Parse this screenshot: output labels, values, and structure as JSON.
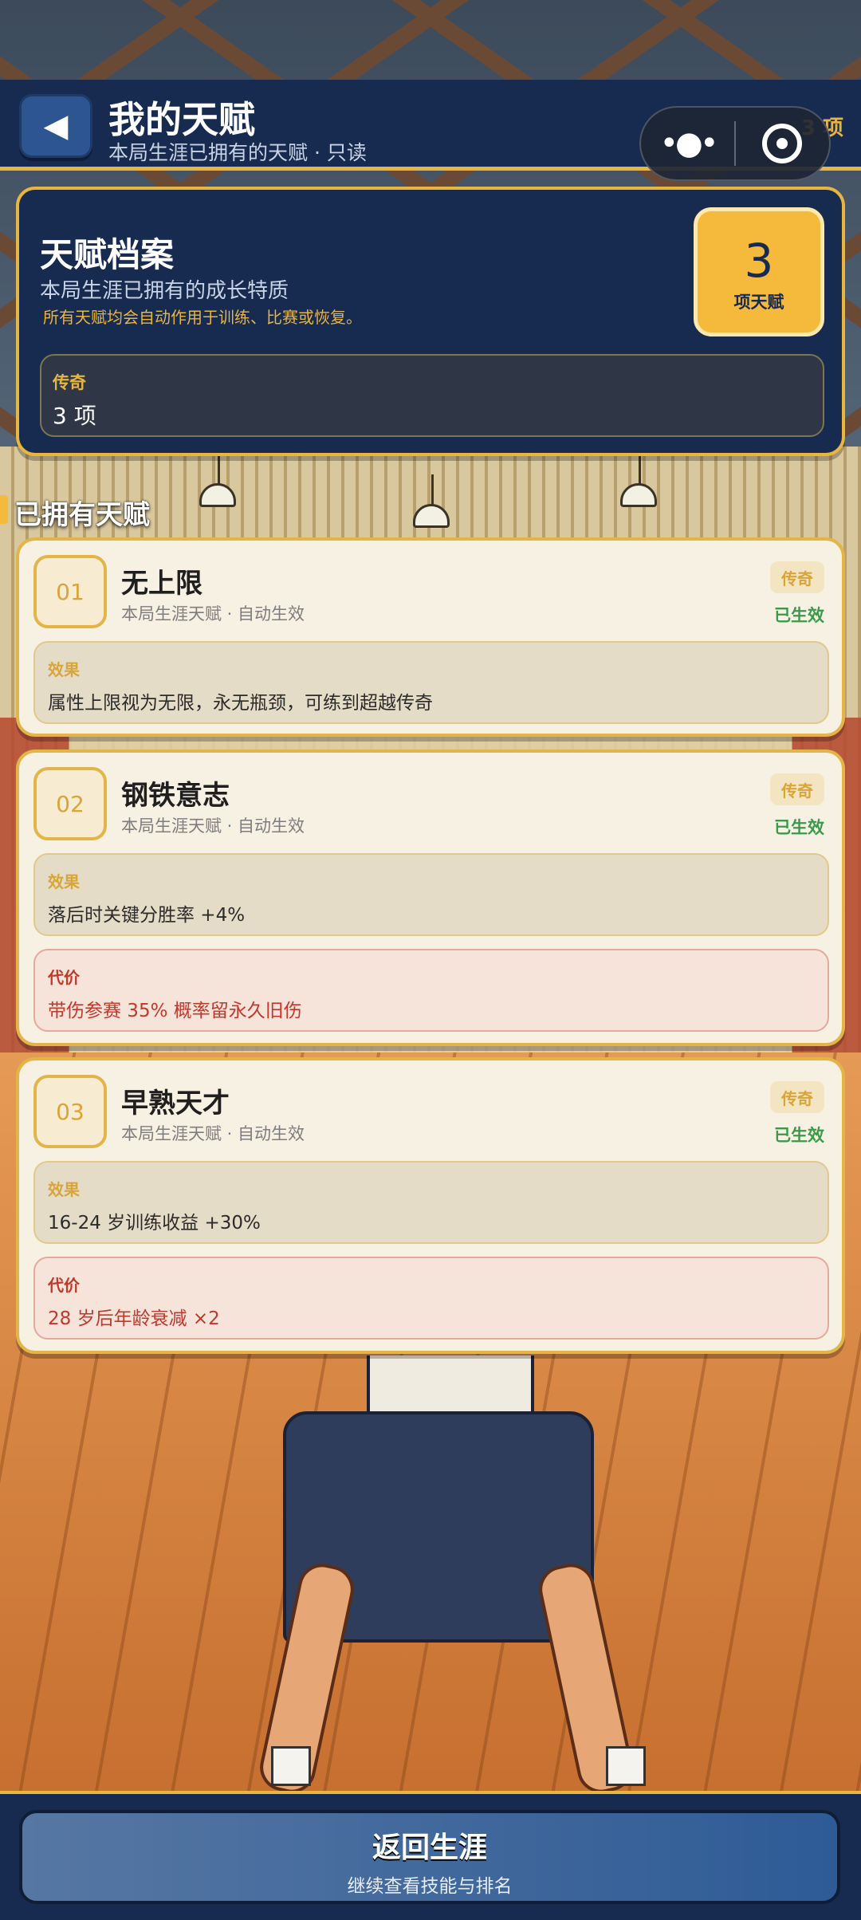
{
  "header": {
    "title": "我的天赋",
    "subtitle": "本局生涯已拥有的天赋 · 只读",
    "count_text": "3 项",
    "back_icon": "back-arrow-icon"
  },
  "capsule": {
    "more_icon": "more-dots-icon",
    "target_icon": "target-icon"
  },
  "profile": {
    "title": "天赋档案",
    "subtitle": "本局生涯已拥有的成长特质",
    "note": "所有天赋均会自动作用于训练、比赛或恢复。",
    "count": "3",
    "count_label": "项天赋",
    "rarity_name": "传奇",
    "rarity_value": "3 项"
  },
  "section": {
    "title": "已拥有天赋"
  },
  "talents": [
    {
      "index": "01",
      "name": "无上限",
      "meta": "本局生涯天赋 · 自动生效",
      "rarity": "传奇",
      "status": "已生效",
      "effect_label": "效果",
      "effect": "属性上限视为无限，永无瓶颈，可练到超越传奇"
    },
    {
      "index": "02",
      "name": "钢铁意志",
      "meta": "本局生涯天赋 · 自动生效",
      "rarity": "传奇",
      "status": "已生效",
      "effect_label": "效果",
      "effect": "落后时关键分胜率 +4%",
      "cost_label": "代价",
      "cost": "带伤参赛 35% 概率留永久旧伤"
    },
    {
      "index": "03",
      "name": "早熟天才",
      "meta": "本局生涯天赋 · 自动生效",
      "rarity": "传奇",
      "status": "已生效",
      "effect_label": "效果",
      "effect": "16-24 岁训练收益 +30%",
      "cost_label": "代价",
      "cost": "28 岁后年龄衰减 ×2"
    }
  ],
  "footer": {
    "button_label": "返回生涯",
    "button_sub": "继续查看技能与排名"
  },
  "colors": {
    "navy": "#172a4f",
    "gold": "#e8b540",
    "card": "#f7f1e3",
    "active_green": "#3a9a4a",
    "cost_red": "#c0392b"
  }
}
